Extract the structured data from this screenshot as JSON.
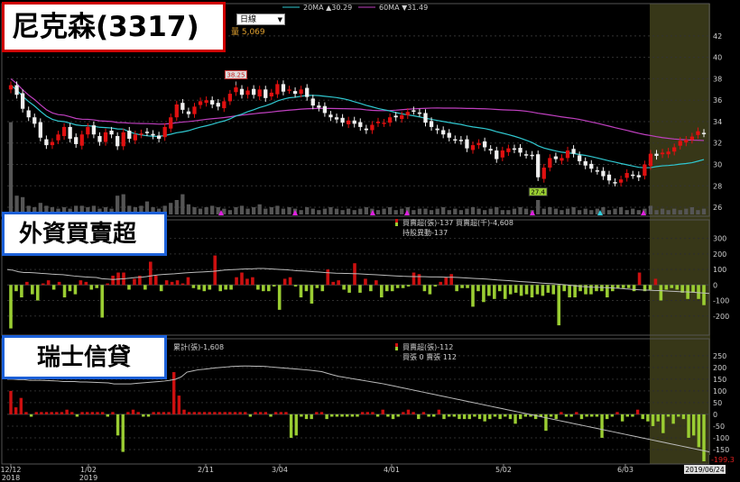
{
  "stock_title": "尼克森(3317)",
  "period": "日線",
  "volume_label": "量 5,069",
  "ma20_label": "20MA ▲30.29",
  "ma60_label": "60MA ▼31.49",
  "high_marker": "38.25",
  "low_marker": "27.4",
  "foreign_label": "外資買賣超",
  "foreign_legend_1": "買賣超(張)-137 買賣超(千)-4,608",
  "foreign_legend_2": "持股異動-137",
  "cs_label": "瑞士信貸",
  "cs_cumulative_label": "累計(張)-1,608",
  "cs_legend_1": "買賣超(張)-112",
  "cs_legend_2": "買張 0 賣張 112",
  "last_value_label": "-199.3",
  "last_date_label": "2019/06/24",
  "x_dates": [
    {
      "label": "12/12",
      "sub": "2018"
    },
    {
      "label": "1/02",
      "sub": "2019"
    },
    {
      "label": "2/11",
      "sub": ""
    },
    {
      "label": "3/04",
      "sub": ""
    },
    {
      "label": "4/01",
      "sub": ""
    },
    {
      "label": "5/02",
      "sub": ""
    },
    {
      "label": "6/03",
      "sub": ""
    }
  ],
  "colors": {
    "up": "#e01010",
    "down": "#f0f0f0",
    "ma20": "#30c8d0",
    "ma60": "#c040c0",
    "buy": "#cc1010",
    "sell": "#9acd32",
    "highlight": "#4a4a20"
  },
  "chart_data": [
    {
      "type": "candlestick",
      "title": "尼克森(3317)",
      "y_ticks": [
        26,
        28,
        30,
        32,
        34,
        36,
        38,
        40,
        42
      ],
      "ylim": [
        25.5,
        43
      ],
      "close": [
        37.4,
        36.5,
        35.2,
        34.4,
        33.8,
        32.5,
        31.8,
        32.1,
        32.8,
        33.5,
        32.4,
        31.9,
        32.8,
        33.5,
        32.8,
        32.1,
        33,
        32.8,
        31.7,
        33,
        32.4,
        32.8,
        32.9,
        33,
        32.7,
        32.4,
        33.5,
        34.4,
        35.6,
        35.1,
        34.7,
        35.4,
        35.9,
        36,
        35.6,
        35.4,
        35.9,
        36.6,
        37.2,
        36.5,
        36.9,
        36.5,
        37,
        36.2,
        36.7,
        37.5,
        36.8,
        37,
        36.6,
        37,
        36.3,
        35.5,
        35.3,
        34.8,
        34.4,
        34.2,
        33.9,
        34.1,
        33.8,
        33.5,
        33.2,
        33.7,
        34,
        33.9,
        34.4,
        34.4,
        34.6,
        34.9,
        35,
        34.8,
        33.9,
        33.5,
        33.2,
        32.8,
        32.5,
        32.3,
        32.2,
        31.5,
        31.8,
        32,
        31.6,
        31.3,
        30.5,
        31.3,
        31.5,
        31.4,
        31.1,
        30.9,
        30.8,
        28.8,
        29.7,
        30.6,
        30.5,
        30.6,
        31.3,
        31,
        30.3,
        29.9,
        29.6,
        29.4,
        28.9,
        28.5,
        28.3,
        28.6,
        29.2,
        29,
        28.8,
        30,
        31,
        30.8,
        31.1,
        31.2,
        31.6,
        32.2,
        32.3,
        32.6,
        33.1,
        32.9
      ]
    },
    {
      "type": "bar",
      "title": "外資買賣超",
      "y_ticks": [
        300,
        200,
        100,
        0,
        -100,
        -200
      ],
      "ylim": [
        -300,
        350
      ],
      "values": [
        -280,
        -40,
        -80,
        20,
        -60,
        -100,
        10,
        30,
        -30,
        20,
        -80,
        -40,
        -60,
        30,
        20,
        -30,
        -20,
        -210,
        10,
        60,
        80,
        80,
        -30,
        40,
        60,
        -30,
        150,
        60,
        -40,
        30,
        20,
        30,
        10,
        50,
        -20,
        -30,
        -40,
        -30,
        190,
        -40,
        -30,
        -30,
        50,
        80,
        40,
        50,
        -30,
        -40,
        -40,
        -10,
        -160,
        40,
        50,
        -10,
        -80,
        -40,
        -120,
        -20,
        -40,
        100,
        20,
        30,
        -30,
        -50,
        140,
        -50,
        40,
        -40,
        30,
        -80,
        -40,
        -40,
        -20,
        -20,
        -10,
        80,
        70,
        -40,
        -60,
        -10,
        20,
        50,
        70,
        -40,
        -20,
        -20,
        -140,
        -40,
        -110,
        -70,
        -90,
        -40,
        -90,
        -60,
        -50,
        -70,
        -60,
        -80,
        -60,
        -70,
        -50,
        -60,
        -260,
        -40,
        -80,
        -80,
        -40,
        -60,
        -60,
        -40,
        -40,
        -80,
        -40,
        -20,
        -20,
        -20,
        -40,
        80,
        -40,
        -30,
        40,
        -100,
        -30,
        -20,
        -30,
        -50,
        -90,
        -50,
        -90,
        -130
      ],
      "line": [
        100,
        95,
        85,
        80,
        80,
        78,
        75,
        73,
        70,
        68,
        66,
        62,
        58,
        55,
        52,
        50,
        48,
        40,
        38,
        35,
        38,
        40,
        44,
        48,
        50,
        54,
        60,
        65,
        68,
        70,
        72,
        75,
        78,
        80,
        82,
        84,
        86,
        88,
        92,
        96,
        98,
        100,
        102,
        103,
        104,
        106,
        106,
        104,
        102,
        100,
        98,
        95,
        92,
        90,
        88,
        85,
        83,
        80,
        78,
        76,
        75,
        74,
        73,
        72,
        70,
        68,
        66,
        64,
        62,
        60,
        58,
        56,
        55,
        54,
        54,
        53,
        52,
        52,
        51,
        50,
        50,
        48,
        46,
        44,
        42,
        40,
        38,
        35,
        32,
        30,
        28,
        25,
        22,
        20,
        18,
        15,
        12,
        10,
        8,
        5,
        2,
        -2,
        -6,
        -10,
        -12,
        -14,
        -15,
        -16,
        -18,
        -20,
        -22,
        -25,
        -28,
        -30,
        -32,
        -33,
        -35,
        -36,
        -38,
        -40,
        -42,
        -44,
        -45,
        -46,
        -50,
        -52,
        -55
      ]
    },
    {
      "type": "bar",
      "title": "瑞士信貸",
      "y_ticks": [
        250,
        200,
        150,
        100,
        50,
        0,
        -50,
        -100,
        -150
      ],
      "ylim": [
        -200,
        280
      ],
      "values": [
        100,
        30,
        70,
        10,
        -10,
        10,
        10,
        10,
        10,
        10,
        10,
        20,
        10,
        -10,
        10,
        10,
        10,
        10,
        10,
        -10,
        10,
        -90,
        -160,
        10,
        20,
        10,
        -10,
        -10,
        10,
        10,
        10,
        10,
        180,
        80,
        20,
        10,
        10,
        10,
        10,
        10,
        10,
        10,
        10,
        10,
        10,
        10,
        10,
        -10,
        10,
        10,
        10,
        -10,
        10,
        10,
        10,
        -100,
        -90,
        -10,
        -20,
        -20,
        10,
        10,
        -20,
        -10,
        -10,
        -10,
        -10,
        -10,
        -10,
        10,
        10,
        10,
        -10,
        20,
        -10,
        -20,
        -10,
        10,
        20,
        10,
        -20,
        10,
        -10,
        -10,
        20,
        -20,
        -10,
        -10,
        -20,
        -20,
        -20,
        -10,
        -20,
        -30,
        -20,
        -10,
        -20,
        -10,
        -20,
        -40,
        -20,
        -10,
        -10,
        -20,
        -10,
        -70,
        -10,
        -20,
        10,
        -10,
        -10,
        10,
        -20,
        -10,
        -10,
        -10,
        -100,
        -20,
        -10,
        10,
        -30,
        -10,
        -10,
        20,
        -20,
        -30,
        -50,
        -30,
        -80,
        -10,
        -40,
        -10,
        -20,
        -100,
        -90,
        -140,
        -200
      ],
      "line": [
        150,
        150,
        148,
        148,
        145,
        145,
        145,
        144,
        143,
        142,
        140,
        140,
        140,
        138,
        138,
        137,
        136,
        135,
        134,
        130,
        130,
        130,
        130,
        132,
        134,
        136,
        138,
        140,
        142,
        145,
        150,
        160,
        180,
        185,
        190,
        192,
        195,
        198,
        200,
        202,
        204,
        205,
        206,
        206,
        205,
        205,
        204,
        202,
        200,
        198,
        196,
        194,
        192,
        190,
        188,
        185,
        182,
        175,
        168,
        162,
        158,
        154,
        150,
        146,
        142,
        138,
        134,
        130,
        125,
        120,
        115,
        110,
        105,
        100,
        95,
        90,
        85,
        80,
        75,
        70,
        65,
        60,
        55,
        50,
        45,
        40,
        35,
        30,
        25,
        20,
        15,
        10,
        5,
        0,
        -5,
        -10,
        -15,
        -20,
        -25,
        -30,
        -35,
        -40,
        -45,
        -50,
        -55,
        -60,
        -65,
        -70,
        -75,
        -80,
        -85,
        -90,
        -95,
        -100,
        -105,
        -110,
        -115,
        -120,
        -125,
        -130,
        -135,
        -140,
        -145,
        -150,
        -155,
        -160
      ]
    }
  ]
}
